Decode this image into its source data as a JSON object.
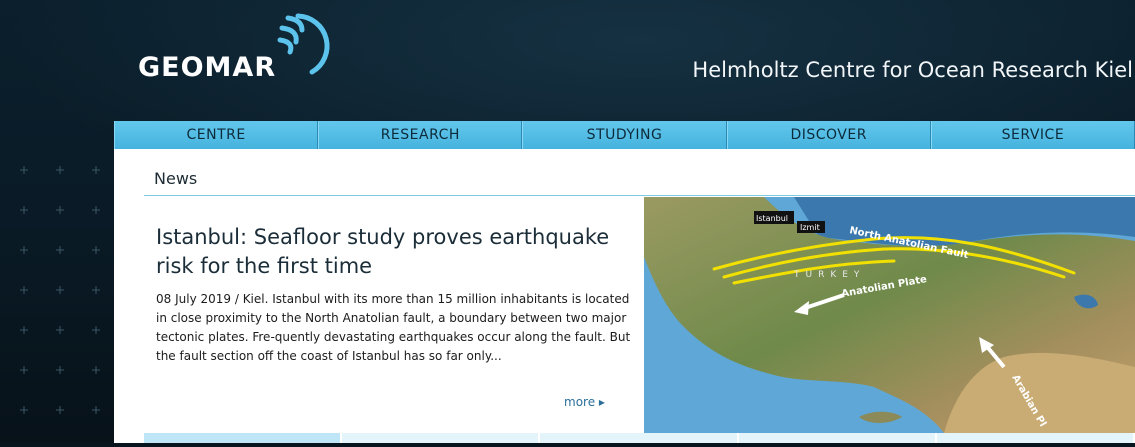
{
  "header": {
    "logo_text": "GEOMAR",
    "tagline": "Helmholtz Centre for Ocean Research Kiel"
  },
  "nav": {
    "items": [
      "CENTRE",
      "RESEARCH",
      "STUDYING",
      "DISCOVER",
      "SERVICE"
    ]
  },
  "news": {
    "section_title": "News",
    "headline": "Istanbul: Seafloor study proves earthquake risk for the first time",
    "date_location": "08 July 2019 / Kiel.",
    "body": "Istanbul with its more than 15 million inhabitants is located in close proximity to the North Anatolian fault, a boundary between two major tectonic plates. Fre-quently devastating earthquakes occur along the fault. But the fault section off the coast of Istanbul has so far only...",
    "more_label": "more ▸",
    "map": {
      "label_istanbul": "Istanbul",
      "label_izmit": "Izmit",
      "label_fault": "North Anatolian Fault",
      "label_country": "TURKEY",
      "label_plate": "Anatolian Plate",
      "label_arabian": "Arabian Pl"
    }
  },
  "colors": {
    "nav_bg": "#52bde5",
    "fault_line": "#f2e000",
    "accent_link": "#2a6f9a"
  }
}
